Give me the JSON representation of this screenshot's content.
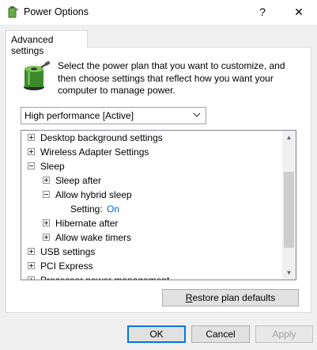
{
  "window": {
    "title": "Power Options",
    "help_glyph": "?",
    "close_glyph": "✕"
  },
  "tabs": [
    {
      "label": "Advanced settings",
      "selected": true
    }
  ],
  "description": "Select the power plan that you want to customize, and then choose settings that reflect how you want your computer to manage power.",
  "plan_select": {
    "value": "High performance [Active]"
  },
  "tree": [
    {
      "label": "Desktop background settings",
      "level": 0,
      "expander": "plus"
    },
    {
      "label": "Wireless Adapter Settings",
      "level": 0,
      "expander": "plus"
    },
    {
      "label": "Sleep",
      "level": 0,
      "expander": "minus"
    },
    {
      "label": "Sleep after",
      "level": 1,
      "expander": "plus"
    },
    {
      "label": "Allow hybrid sleep",
      "level": 1,
      "expander": "minus"
    },
    {
      "label": "Setting:",
      "level": 2,
      "expander": "none",
      "value": "On"
    },
    {
      "label": "Hibernate after",
      "level": 1,
      "expander": "plus"
    },
    {
      "label": "Allow wake timers",
      "level": 1,
      "expander": "plus"
    },
    {
      "label": "USB settings",
      "level": 0,
      "expander": "plus"
    },
    {
      "label": "PCI Express",
      "level": 0,
      "expander": "plus"
    },
    {
      "label": "Processor power management",
      "level": 0,
      "expander": "plus"
    }
  ],
  "buttons": {
    "restore_prefix": "",
    "restore_accel": "R",
    "restore_rest": "estore plan defaults",
    "ok": "OK",
    "cancel": "Cancel",
    "apply": "Apply"
  },
  "colors": {
    "setting_value": "#0066cc",
    "focus_border": "#0078d7"
  },
  "icons": {
    "app": "power-options-icon",
    "battery": "battery-plug-icon"
  }
}
